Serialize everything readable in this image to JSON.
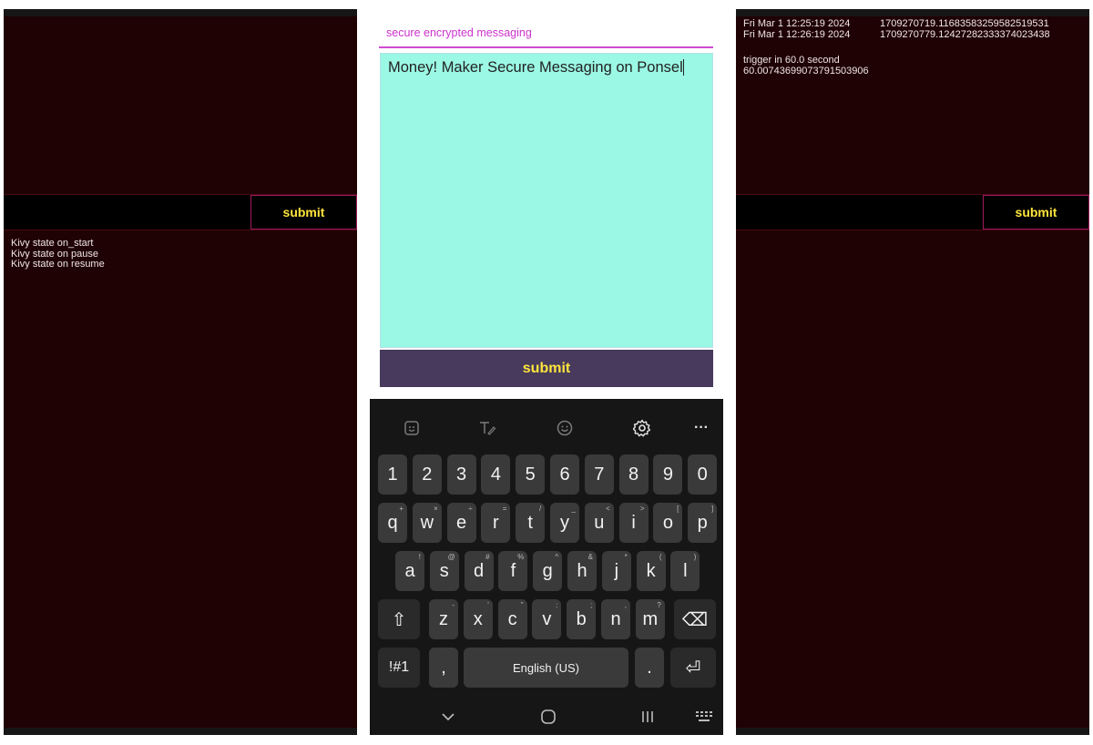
{
  "left_panel": {
    "submit_label": "submit",
    "log_lines": [
      "Kivy state on_start",
      "Kivy state on pause",
      "Kivy state on resume"
    ]
  },
  "phone": {
    "title": "secure encrypted messaging",
    "message_text": "Money! Maker Secure Messaging on Ponsel",
    "submit_label": "submit",
    "keyboard": {
      "toolbar_icons": [
        "sticker-icon",
        "handwriting-icon",
        "emoji-icon",
        "settings-icon",
        "more-icon"
      ],
      "more_label": "···",
      "row_numbers": [
        "1",
        "2",
        "3",
        "4",
        "5",
        "6",
        "7",
        "8",
        "9",
        "0"
      ],
      "row_qwerty": [
        {
          "k": "q",
          "h": "+"
        },
        {
          "k": "w",
          "h": "×"
        },
        {
          "k": "e",
          "h": "÷"
        },
        {
          "k": "r",
          "h": "="
        },
        {
          "k": "t",
          "h": "/"
        },
        {
          "k": "y",
          "h": "_"
        },
        {
          "k": "u",
          "h": "<"
        },
        {
          "k": "i",
          "h": ">"
        },
        {
          "k": "o",
          "h": "["
        },
        {
          "k": "p",
          "h": "]"
        }
      ],
      "row_asdf": [
        {
          "k": "a",
          "h": "!"
        },
        {
          "k": "s",
          "h": "@"
        },
        {
          "k": "d",
          "h": "#"
        },
        {
          "k": "f",
          "h": "%"
        },
        {
          "k": "g",
          "h": "^"
        },
        {
          "k": "h",
          "h": "&"
        },
        {
          "k": "j",
          "h": "*"
        },
        {
          "k": "k",
          "h": "("
        },
        {
          "k": "l",
          "h": ")"
        }
      ],
      "row_zxcv": [
        {
          "k": "z",
          "h": "-"
        },
        {
          "k": "x",
          "h": "'"
        },
        {
          "k": "c",
          "h": "\""
        },
        {
          "k": "v",
          "h": ":"
        },
        {
          "k": "b",
          "h": ";"
        },
        {
          "k": "n",
          "h": ","
        },
        {
          "k": "m",
          "h": "?"
        }
      ],
      "symbols_label": "!#1",
      "comma_label": ",",
      "space_label": "English (US)",
      "period_label": ".",
      "shift_icon": "⇧",
      "backspace_icon": "⌫",
      "enter_icon": "⏎"
    },
    "navbar": {
      "back": "⌄",
      "home": "○",
      "recent": "|||",
      "keyboard_switch": "⌨"
    }
  },
  "right_panel": {
    "timestamps": [
      {
        "date": "Fri Mar  1 12:25:19 2024",
        "epoch": "1709270719.1168358325958251953​1"
      },
      {
        "date": "Fri Mar  1 12:26:19 2024",
        "epoch": "1709270779.12427282333374023438"
      }
    ],
    "log_lines": [
      "trigger in 60.0 second",
      "60.00743699073791503906"
    ],
    "submit_label": "submit"
  },
  "colors": {
    "panel_bg": "#1f0204",
    "accent_yellow": "#ffe53b",
    "title_magenta": "#cc33cc",
    "message_bg": "#9bf8e4",
    "submit_bg": "#473a5c",
    "keyboard_bg": "#161616",
    "key_bg": "#3a3a3a"
  }
}
